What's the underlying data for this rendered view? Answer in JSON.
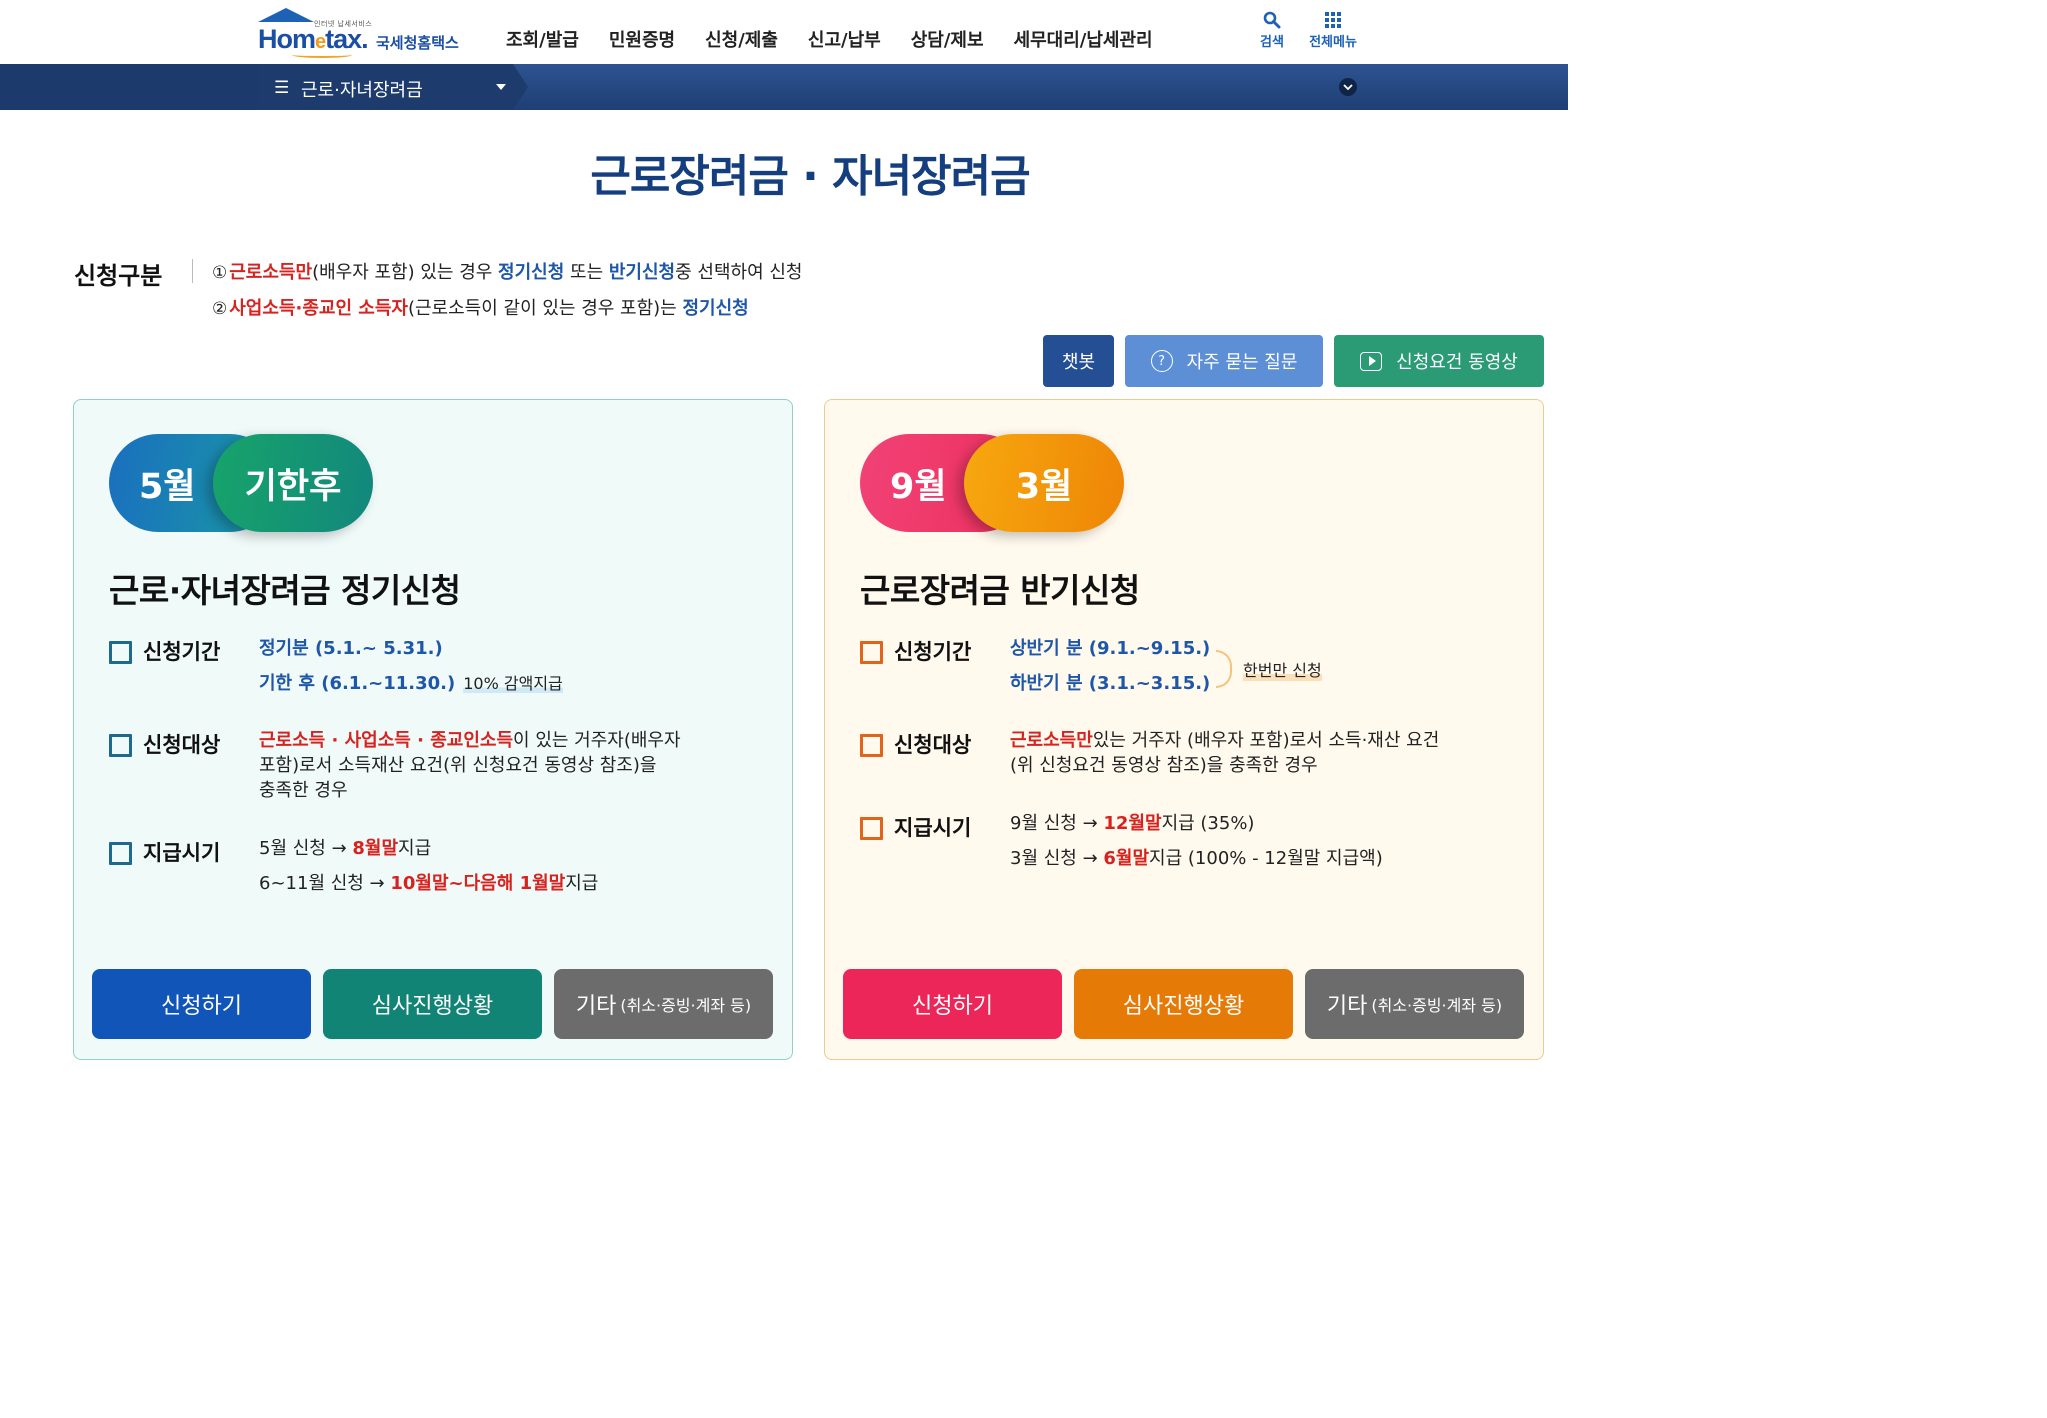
{
  "header": {
    "logo_tagline": "인터넷 납세서비스",
    "logo_word_pre": "Hom",
    "logo_word_e": "e",
    "logo_word_post": "tax.",
    "logo_kor": "국세청홈택스",
    "menu": [
      "조회/발급",
      "민원증명",
      "신청/제출",
      "신고/납부",
      "상담/제보",
      "세무대리/납세관리"
    ],
    "search_label": "검색",
    "all_menu_label": "전체메뉴"
  },
  "nav": {
    "current": "근로·자녀장려금"
  },
  "page": {
    "title": "근로장려금 · 자녀장려금"
  },
  "guide": {
    "title": "신청구분",
    "line1": {
      "num": "①",
      "red": "근로소득만",
      "t1": "(배우자 포함) 있는 경우 ",
      "blue1": "정기신청",
      "t2": " 또는 ",
      "blue2": "반기신청",
      "t3": "중 선택하여 신청"
    },
    "line2": {
      "num": "②",
      "red": "사업소득·종교인 소득자",
      "t1": "(근로소득이 같이 있는 경우 포함)는 ",
      "blue1": "정기신청"
    }
  },
  "top_buttons": {
    "chatbot": "챗봇",
    "faq": "자주 묻는 질문",
    "video": "신청요건 동영상"
  },
  "card_regular": {
    "pill_left": "5월",
    "pill_right": "기한후",
    "title": "근로·자녀장려금 정기신청",
    "period_label": "신청기간",
    "period_line1": "정기분 (5.1.~ 5.31.)",
    "period_line2": "기한 후 (6.1.~11.30.)",
    "period_note": "10% 감액지급",
    "target_label": "신청대상",
    "target_red": "근로소득 · 사업소득 · 종교인소득",
    "target_text_1": "이 있는 거주자(배우자",
    "target_text_2": "포함)로서 소득재산 요건(위 신청요건 동영상 참조)을",
    "target_text_3": "충족한 경우",
    "pay_label": "지급시기",
    "pay1_pre": "5월 신청 → ",
    "pay1_red": "8월말",
    "pay1_post": "지급",
    "pay2_pre": "6~11월 신청 → ",
    "pay2_red": "10월말~다음해 1월말",
    "pay2_post": "지급",
    "btn_apply": "신청하기",
    "btn_status": "심사진행상황",
    "btn_etc": "기타",
    "btn_etc_small": "(취소·증빙·계좌 등)",
    "colors": {
      "apply": "#1155b8",
      "status": "#118475",
      "etc": "#6c6c6c"
    }
  },
  "card_half": {
    "pill_left": "9월",
    "pill_right": "3월",
    "title": "근로장려금 반기신청",
    "period_label": "신청기간",
    "period_line1": "상반기 분 (9.1.~9.15.)",
    "period_line2": "하반기 분 (3.1.~3.15.)",
    "period_note": "한번만 신청",
    "target_label": "신청대상",
    "target_red": "근로소득만",
    "target_text_1": "있는 거주자 (배우자 포함)로서 소득·재산 요건",
    "target_text_2": "(위 신청요건 동영상 참조)을 충족한 경우",
    "pay_label": "지급시기",
    "pay1_pre": "9월 신청 → ",
    "pay1_red": "12월말",
    "pay1_post": "지급 (35%)",
    "pay2_pre": "3월 신청 → ",
    "pay2_red": "6월말",
    "pay2_post": "지급 (100% - 12월말 지급액)",
    "btn_apply": "신청하기",
    "btn_status": "심사진행상황",
    "btn_etc": "기타",
    "btn_etc_small": "(취소·증빙·계좌 등)",
    "colors": {
      "apply": "#ec2658",
      "status": "#e57b06",
      "etc": "#6c6c6c"
    }
  }
}
